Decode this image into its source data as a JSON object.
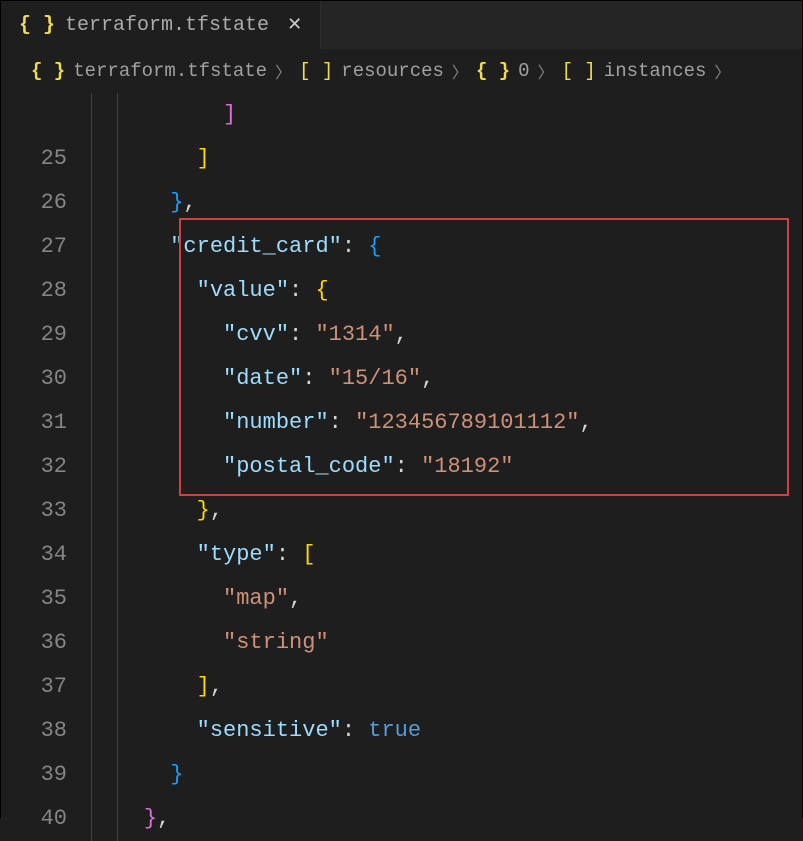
{
  "tab": {
    "label": "terraform.tfstate",
    "icon": "{ }"
  },
  "breadcrumb": {
    "file": "terraform.tfstate",
    "parts": [
      {
        "icon": "[ ]",
        "label": "resources"
      },
      {
        "icon": "{ }",
        "label": "0"
      },
      {
        "icon": "[ ]",
        "label": "instances"
      }
    ]
  },
  "lines": {
    "start": 25,
    "count": 16
  },
  "code": {
    "l25_bracket": "]",
    "l26_brace": "}",
    "l26_comma": ",",
    "l27_key": "\"credit_card\"",
    "l27_colon": ":",
    "l27_brace": "{",
    "l28_key": "\"value\"",
    "l28_colon": ":",
    "l28_brace": "{",
    "l29_key": "\"cvv\"",
    "l29_colon": ":",
    "l29_val": "\"1314\"",
    "l29_comma": ",",
    "l30_key": "\"date\"",
    "l30_colon": ":",
    "l30_val": "\"15/16\"",
    "l30_comma": ",",
    "l31_key": "\"number\"",
    "l31_colon": ":",
    "l31_val": "\"123456789101112\"",
    "l31_comma": ",",
    "l32_key": "\"postal_code\"",
    "l32_colon": ":",
    "l32_val": "\"18192\"",
    "l33_brace": "}",
    "l33_comma": ",",
    "l34_key": "\"type\"",
    "l34_colon": ":",
    "l34_bracket": "[",
    "l35_val": "\"map\"",
    "l35_comma": ",",
    "l36_val": "\"string\"",
    "l37_bracket": "]",
    "l37_comma": ",",
    "l38_key": "\"sensitive\"",
    "l38_colon": ":",
    "l38_val": "true",
    "l39_brace": "}",
    "l40_brace": "}",
    "l40_comma": ","
  }
}
